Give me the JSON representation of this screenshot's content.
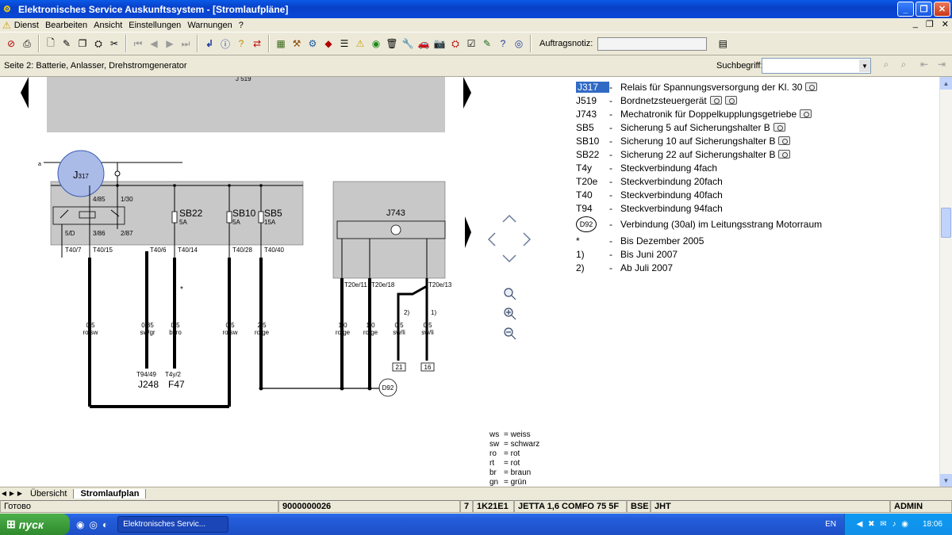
{
  "window": {
    "title": "Elektronisches Service Auskunftssystem - [Stromlaufpläne]",
    "app_icon": "esa-icon"
  },
  "menu": [
    "Dienst",
    "Bearbeiten",
    "Ansicht",
    "Einstellungen",
    "Warnungen",
    "?"
  ],
  "toolbar": {
    "note_label": "Auftragsnotiz:",
    "note_value": ""
  },
  "searchbar": {
    "page_label": "Seite 2: Batterie, Anlasser, Drehstromgenerator",
    "search_label": "Suchbegriff:",
    "search_value": ""
  },
  "schematic": {
    "components": [
      "J317",
      "J743",
      "SB22",
      "SB10",
      "SB5",
      "J519"
    ],
    "fuse_ratings": {
      "SB22": "5A",
      "SB10": "5A",
      "SB5": "15A"
    },
    "pins": [
      "4/85",
      "1/30",
      "5/D",
      "3/86",
      "2/87",
      "T40/7",
      "T40/15",
      "T40/6",
      "T40/14",
      "T40/28",
      "T40/40",
      "T20e/11",
      "T20e/18",
      "T20e/13"
    ],
    "wires": [
      {
        "size": "0,5",
        "color": "ro/sw"
      },
      {
        "size": "0,35",
        "color": "sw/gr"
      },
      {
        "size": "0,5",
        "color": "bl/ro"
      },
      {
        "size": "0,5",
        "color": "ro/sw"
      },
      {
        "size": "2,5",
        "color": "ro/ge"
      },
      {
        "size": "1,0",
        "color": "ro/ge"
      },
      {
        "size": "1,0",
        "color": "ro/ge"
      },
      {
        "size": "0,5",
        "color": "sw/li"
      },
      {
        "size": "0,5",
        "color": "sw/li"
      }
    ],
    "refs": {
      "T94_49": "T94/49",
      "J248": "J248",
      "T4y_2": "T4y/2",
      "F47": "F47",
      "D92": "D92",
      "b21": "21",
      "b16": "16",
      "n1": "1)",
      "n2": "2)",
      "a": "a",
      "star": "*"
    }
  },
  "legend": [
    {
      "code": "J317",
      "desc": "Relais für Spannungsversorgung der Kl. 30",
      "photos": 1,
      "selected": true
    },
    {
      "code": "J519",
      "desc": "Bordnetzsteuergerät",
      "photos": 2,
      "selected": false
    },
    {
      "code": "J743",
      "desc": "Mechatronik für Doppelkupplungsgetriebe",
      "photos": 1,
      "selected": false
    },
    {
      "code": "SB5",
      "desc": "Sicherung 5 auf Sicherungshalter B",
      "photos": 1,
      "selected": false
    },
    {
      "code": "SB10",
      "desc": "Sicherung 10 auf Sicherungshalter B",
      "photos": 1,
      "selected": false
    },
    {
      "code": "SB22",
      "desc": "Sicherung 22 auf Sicherungshalter B",
      "photos": 1,
      "selected": false
    },
    {
      "code": "T4y",
      "desc": "Steckverbindung 4fach",
      "photos": 0,
      "selected": false
    },
    {
      "code": "T20e",
      "desc": "Steckverbindung 20fach",
      "photos": 0,
      "selected": false
    },
    {
      "code": "T40",
      "desc": "Steckverbindung 40fach",
      "photos": 0,
      "selected": false
    },
    {
      "code": "T94",
      "desc": "Steckverbindung 94fach",
      "photos": 0,
      "selected": false
    },
    {
      "code": "D92",
      "desc": "Verbindung (30al) im Leitungsstrang Motorraum",
      "photos": 0,
      "selected": false,
      "circle": true
    },
    {
      "code": "*",
      "desc": "Bis Dezember 2005",
      "photos": 0,
      "selected": false
    },
    {
      "code": "1)",
      "desc": "Bis Juni 2007",
      "photos": 0,
      "selected": false
    },
    {
      "code": "2)",
      "desc": "Ab Juli 2007",
      "photos": 0,
      "selected": false
    }
  ],
  "color_codes": [
    {
      "code": "ws",
      "name": "= weiss"
    },
    {
      "code": "sw",
      "name": "= schwarz"
    },
    {
      "code": "ro",
      "name": "= rot"
    },
    {
      "code": "rt",
      "name": "= rot"
    },
    {
      "code": "br",
      "name": "= braun"
    },
    {
      "code": "gn",
      "name": "= grün"
    }
  ],
  "tabs": [
    "Übersicht",
    "Stromlaufplan"
  ],
  "status": {
    "state": "Готово",
    "order": "9000000026",
    "num": "7",
    "model_code": "1K21E1",
    "model": "JETTA 1,6 COMFO 75 5F",
    "engine": "BSE",
    "gearbox": "JHT",
    "user": "ADMIN"
  },
  "taskbar": {
    "start": "пуск",
    "task": "Elektronisches Servic...",
    "lang": "EN",
    "clock": "18:06"
  },
  "colors": {
    "titlebar": "#0a48d8",
    "selection": "#316ac5",
    "module_fill": "#c8c8c8",
    "taskbar": "#245edb",
    "start": "#3c9a3a"
  }
}
